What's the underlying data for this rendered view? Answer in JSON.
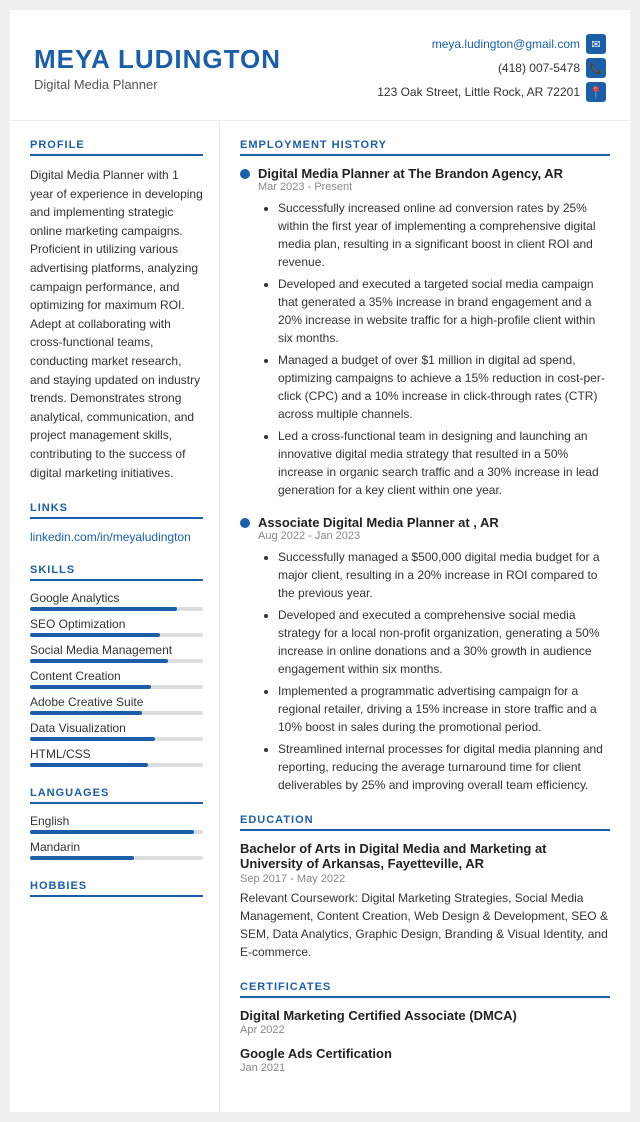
{
  "header": {
    "name": "MEYA LUDINGTON",
    "title": "Digital Media Planner",
    "email": "meya.ludington@gmail.com",
    "phone": "(418) 007-5478",
    "address": "123 Oak Street, Little Rock, AR 72201"
  },
  "profile": {
    "title": "PROFILE",
    "text": "Digital Media Planner with 1 year of experience in developing and implementing strategic online marketing campaigns. Proficient in utilizing various advertising platforms, analyzing campaign performance, and optimizing for maximum ROI. Adept at collaborating with cross-functional teams, conducting market research, and staying updated on industry trends. Demonstrates strong analytical, communication, and project management skills, contributing to the success of digital marketing initiatives."
  },
  "links": {
    "title": "LINKS",
    "items": [
      {
        "text": "linkedin.com/in/meyaludington",
        "url": "#"
      }
    ]
  },
  "skills": {
    "title": "SKILLS",
    "items": [
      {
        "name": "Google Analytics",
        "pct": 85
      },
      {
        "name": "SEO Optimization",
        "pct": 75
      },
      {
        "name": "Social Media Management",
        "pct": 80
      },
      {
        "name": "Content Creation",
        "pct": 70
      },
      {
        "name": "Adobe Creative Suite",
        "pct": 65
      },
      {
        "name": "Data Visualization",
        "pct": 72
      },
      {
        "name": "HTML/CSS",
        "pct": 68
      }
    ]
  },
  "languages": {
    "title": "LANGUAGES",
    "items": [
      {
        "name": "English",
        "pct": 95
      },
      {
        "name": "Mandarin",
        "pct": 60
      }
    ]
  },
  "hobbies": {
    "title": "HOBBIES"
  },
  "employment": {
    "title": "EMPLOYMENT HISTORY",
    "jobs": [
      {
        "title": "Digital Media Planner at The Brandon Agency, AR",
        "date": "Mar 2023 - Present",
        "bullets": [
          "Successfully increased online ad conversion rates by 25% within the first year of implementing a comprehensive digital media plan, resulting in a significant boost in client ROI and revenue.",
          "Developed and executed a targeted social media campaign that generated a 35% increase in brand engagement and a 20% increase in website traffic for a high-profile client within six months.",
          "Managed a budget of over $1 million in digital ad spend, optimizing campaigns to achieve a 15% reduction in cost-per-click (CPC) and a 10% increase in click-through rates (CTR) across multiple channels.",
          "Led a cross-functional team in designing and launching an innovative digital media strategy that resulted in a 50% increase in organic search traffic and a 30% increase in lead generation for a key client within one year."
        ]
      },
      {
        "title": "Associate Digital Media Planner at , AR",
        "date": "Aug 2022 - Jan 2023",
        "bullets": [
          "Successfully managed a $500,000 digital media budget for a major client, resulting in a 20% increase in ROI compared to the previous year.",
          "Developed and executed a comprehensive social media strategy for a local non-profit organization, generating a 50% increase in online donations and a 30% growth in audience engagement within six months.",
          "Implemented a programmatic advertising campaign for a regional retailer, driving a 15% increase in store traffic and a 10% boost in sales during the promotional period.",
          "Streamlined internal processes for digital media planning and reporting, reducing the average turnaround time for client deliverables by 25% and improving overall team efficiency."
        ]
      }
    ]
  },
  "education": {
    "title": "EDUCATION",
    "degree": "Bachelor of Arts in Digital Media and Marketing at University of Arkansas, Fayetteville, AR",
    "date": "Sep 2017 - May 2022",
    "coursework": "Relevant Coursework: Digital Marketing Strategies, Social Media Management, Content Creation, Web Design & Development, SEO & SEM, Data Analytics, Graphic Design, Branding & Visual Identity, and E-commerce."
  },
  "certificates": {
    "title": "CERTIFICATES",
    "items": [
      {
        "name": "Digital Marketing Certified Associate (DMCA)",
        "date": "Apr 2022"
      },
      {
        "name": "Google Ads Certification",
        "date": "Jan 2021"
      }
    ]
  }
}
